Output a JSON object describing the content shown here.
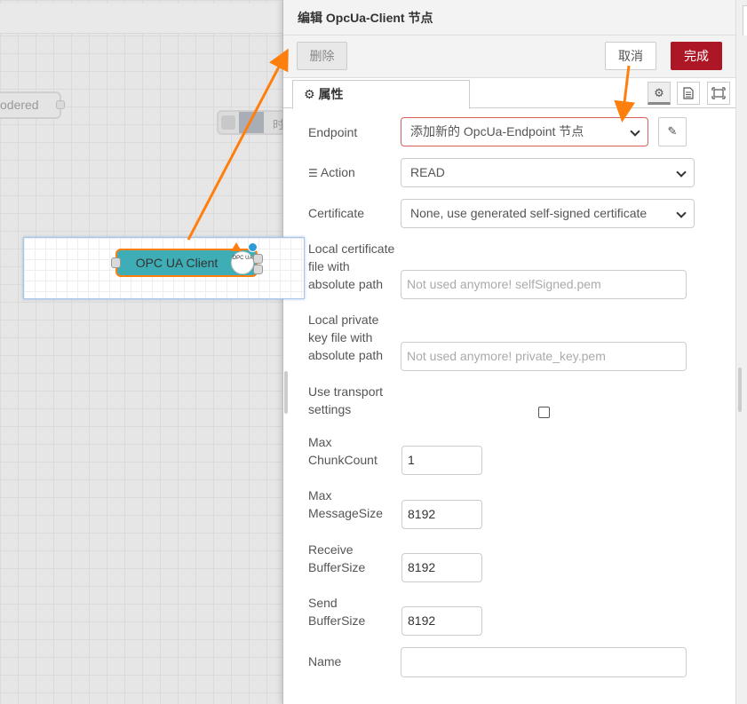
{
  "workspace": {
    "ghost_node_label": "odered",
    "ghost_node2_label": "时",
    "node": {
      "label": "OPC UA Client",
      "logo_text": "OPC UA"
    }
  },
  "tray": {
    "title": "编辑 OpcUa-Client 节点",
    "toolbar": {
      "delete_label": "删除",
      "cancel_label": "取消",
      "done_label": "完成"
    },
    "tabs": {
      "properties_label": "属性"
    },
    "form": {
      "endpoint_label": "Endpoint",
      "endpoint_value": "添加新的 OpcUa-Endpoint 节点",
      "action_label": "Action",
      "action_value": "READ",
      "certificate_label": "Certificate",
      "certificate_value": "None, use generated self-signed certificate",
      "local_cert_label_1": "Local certificate",
      "local_cert_label_2": "file with",
      "local_cert_label_3": "absolute path",
      "local_cert_placeholder": "Not used anymore! selfSigned.pem",
      "local_key_label_1": "Local private",
      "local_key_label_2": "key file with",
      "local_key_label_3": "absolute path",
      "local_key_placeholder": "Not used anymore! private_key.pem",
      "transport_label_1": "Use transport",
      "transport_label_2": "settings",
      "transport_checked": false,
      "max_chunk_label_1": "Max",
      "max_chunk_label_2": "ChunkCount",
      "max_chunk_value": "1",
      "max_msg_label_1": "Max",
      "max_msg_label_2": "MessageSize",
      "max_msg_value": "8192",
      "recv_label_1": "Receive",
      "recv_label_2": "BufferSize",
      "recv_value": "8192",
      "send_label_1": "Send",
      "send_label_2": "BufferSize",
      "send_value": "8192",
      "name_label": "Name",
      "name_value": ""
    }
  },
  "colors": {
    "accent": "#ad1625",
    "node": "#3fadb5",
    "annotation": "#ff7f0e",
    "invalid": "#d6615a"
  },
  "icons": [
    "gear-icon",
    "list-icon",
    "pencil-icon",
    "document-icon",
    "frame-icon",
    "warning-icon",
    "chevron-down-icon"
  ]
}
